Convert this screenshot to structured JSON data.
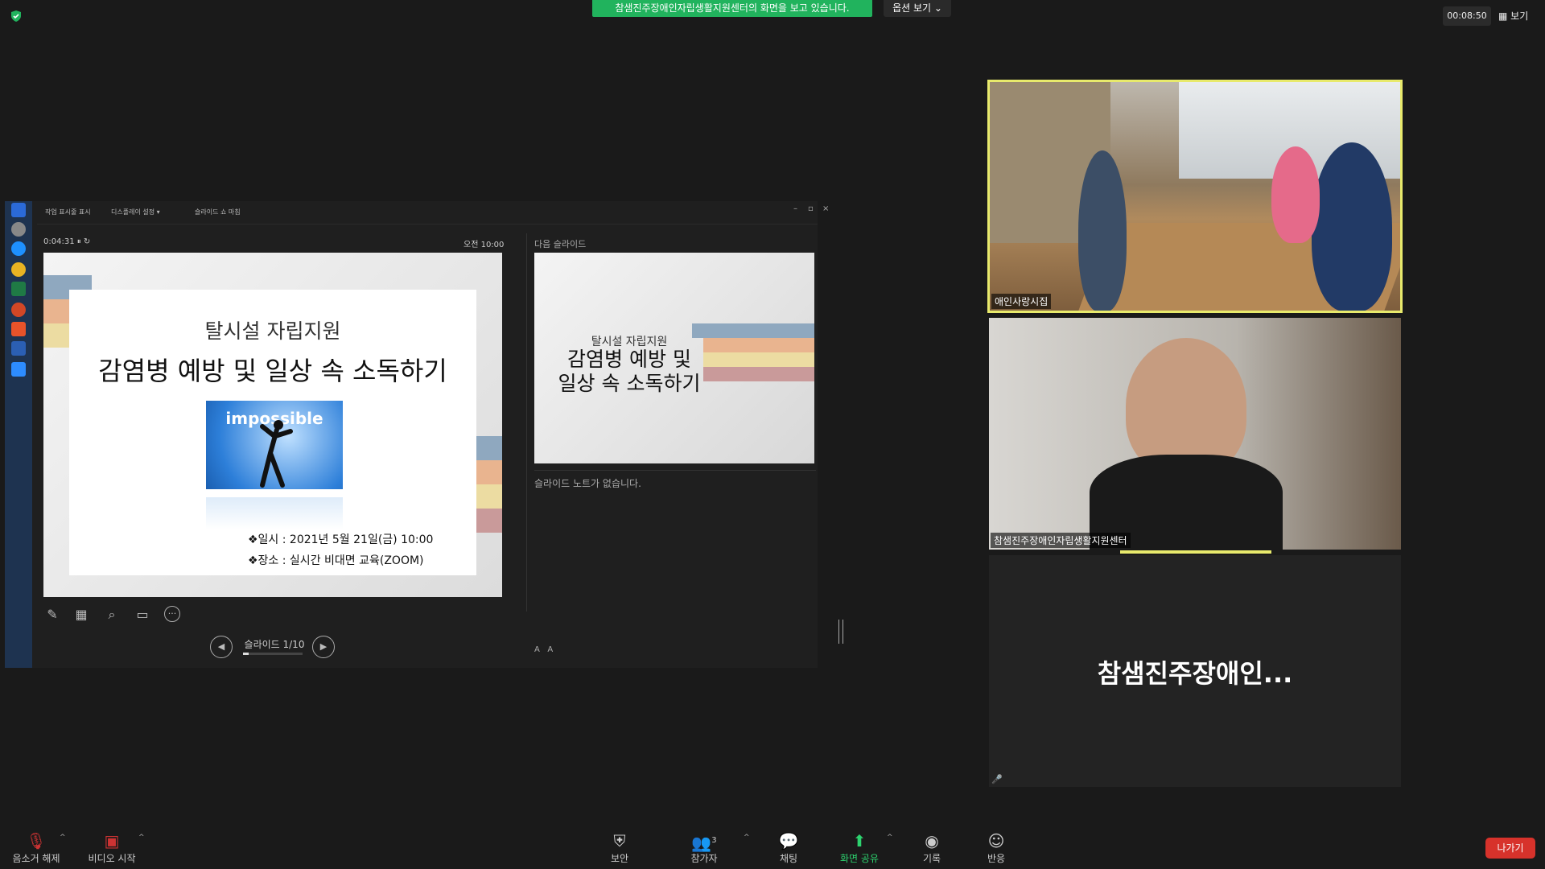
{
  "top": {
    "share_banner": "참샘진주장애인자립생활지원센터의 화면을 보고 있습니다.",
    "view_options": "옵션 보기 ⌄",
    "timer": "00:08:50",
    "view_label": "▦ 보기"
  },
  "presenter": {
    "toolbar": [
      "작업 표시줄 표시",
      "디스플레이 설정 ▾",
      "슬라이드 쇼 마침"
    ],
    "elapsed": "0:04:31",
    "clock": "오전 10:00",
    "next_label": "다음 슬라이드",
    "slide": {
      "subtitle": "탈시설 자립지원",
      "title": "감염병 예방 및 일상 속 소독하기",
      "image_text": "impossible",
      "date": "❖일시 : 2021년 5월 21일(금) 10:00",
      "place": "❖장소 : 실시간 비대면 교육(ZOOM)"
    },
    "next_slide": {
      "subtitle": "탈시설 자립지원",
      "title_line1": "감염병 예방 및",
      "title_line2": "일상 속 소독하기"
    },
    "notes": "슬라이드 노트가 없습니다.",
    "counter": "슬라이드 1/10",
    "progress": 0.1
  },
  "tiles": {
    "tile1_name": "애인사랑시집",
    "tile2_name": "참샘진주장애인자립생활지원센터",
    "tile3_name": "참샘진주장애인..."
  },
  "bottom": {
    "mute": "음소거 해제",
    "video": "비디오 시작",
    "security": "보안",
    "participants": "참가자",
    "participants_count": "3",
    "chat": "채팅",
    "share": "화면 공유",
    "record": "기록",
    "reactions": "반응",
    "leave": "나가기"
  },
  "colors": {
    "share_green": "#21b35d",
    "active_speaker": "#e8ea6c",
    "leave_red": "#d7322b"
  }
}
